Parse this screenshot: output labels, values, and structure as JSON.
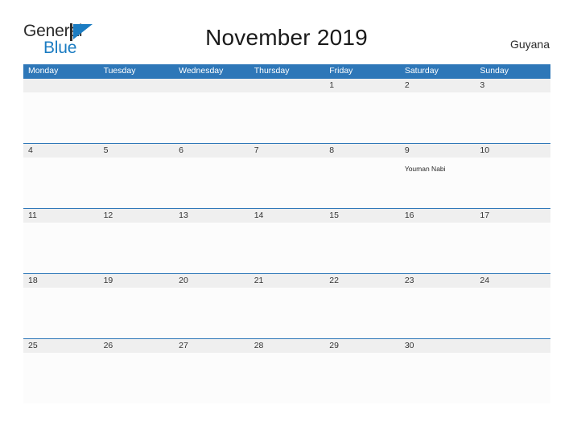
{
  "header": {
    "logo": {
      "word_one": "General",
      "word_two": "Blue",
      "accent_color": "#1b7cc2"
    },
    "title": "November 2019",
    "country": "Guyana"
  },
  "calendar": {
    "header_color": "#2e77b8",
    "date_band_color": "#efefef",
    "weekdays": [
      "Monday",
      "Tuesday",
      "Wednesday",
      "Thursday",
      "Friday",
      "Saturday",
      "Sunday"
    ],
    "weeks": [
      {
        "dates": [
          "",
          "",
          "",
          "",
          "1",
          "2",
          "3"
        ],
        "events": [
          "",
          "",
          "",
          "",
          "",
          "",
          ""
        ]
      },
      {
        "dates": [
          "4",
          "5",
          "6",
          "7",
          "8",
          "9",
          "10"
        ],
        "events": [
          "",
          "",
          "",
          "",
          "",
          "Youman Nabi",
          ""
        ]
      },
      {
        "dates": [
          "11",
          "12",
          "13",
          "14",
          "15",
          "16",
          "17"
        ],
        "events": [
          "",
          "",
          "",
          "",
          "",
          "",
          ""
        ]
      },
      {
        "dates": [
          "18",
          "19",
          "20",
          "21",
          "22",
          "23",
          "24"
        ],
        "events": [
          "",
          "",
          "",
          "",
          "",
          "",
          ""
        ]
      },
      {
        "dates": [
          "25",
          "26",
          "27",
          "28",
          "29",
          "30",
          ""
        ],
        "events": [
          "",
          "",
          "",
          "",
          "",
          "",
          ""
        ]
      }
    ]
  }
}
